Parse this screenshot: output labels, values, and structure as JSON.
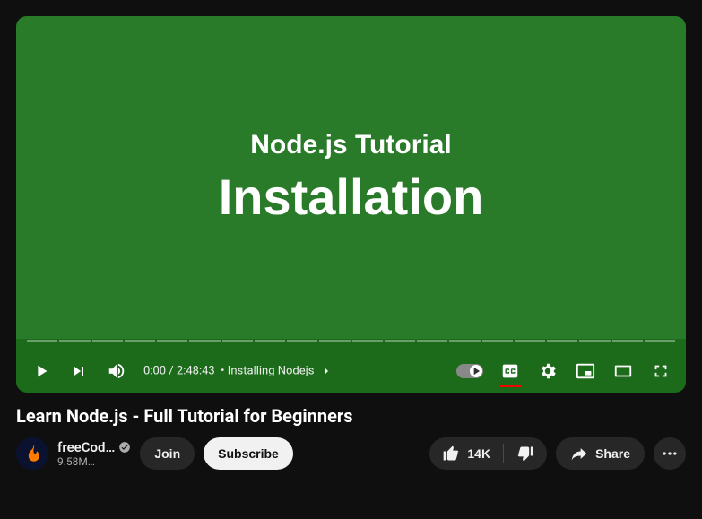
{
  "player": {
    "video_overlay_top": "Node.js Tutorial",
    "video_overlay_main": "Installation",
    "time_current": "0:00",
    "time_total": "2:48:43",
    "chapter_label": "Installing Nodejs",
    "segment_count": 20
  },
  "video": {
    "title": "Learn Node.js - Full Tutorial for Beginners",
    "channel_name": "freeCod…",
    "subscribers": "9.58M…",
    "likes_label": "14K",
    "join_label": "Join",
    "subscribe_label": "Subscribe",
    "share_label": "Share"
  }
}
